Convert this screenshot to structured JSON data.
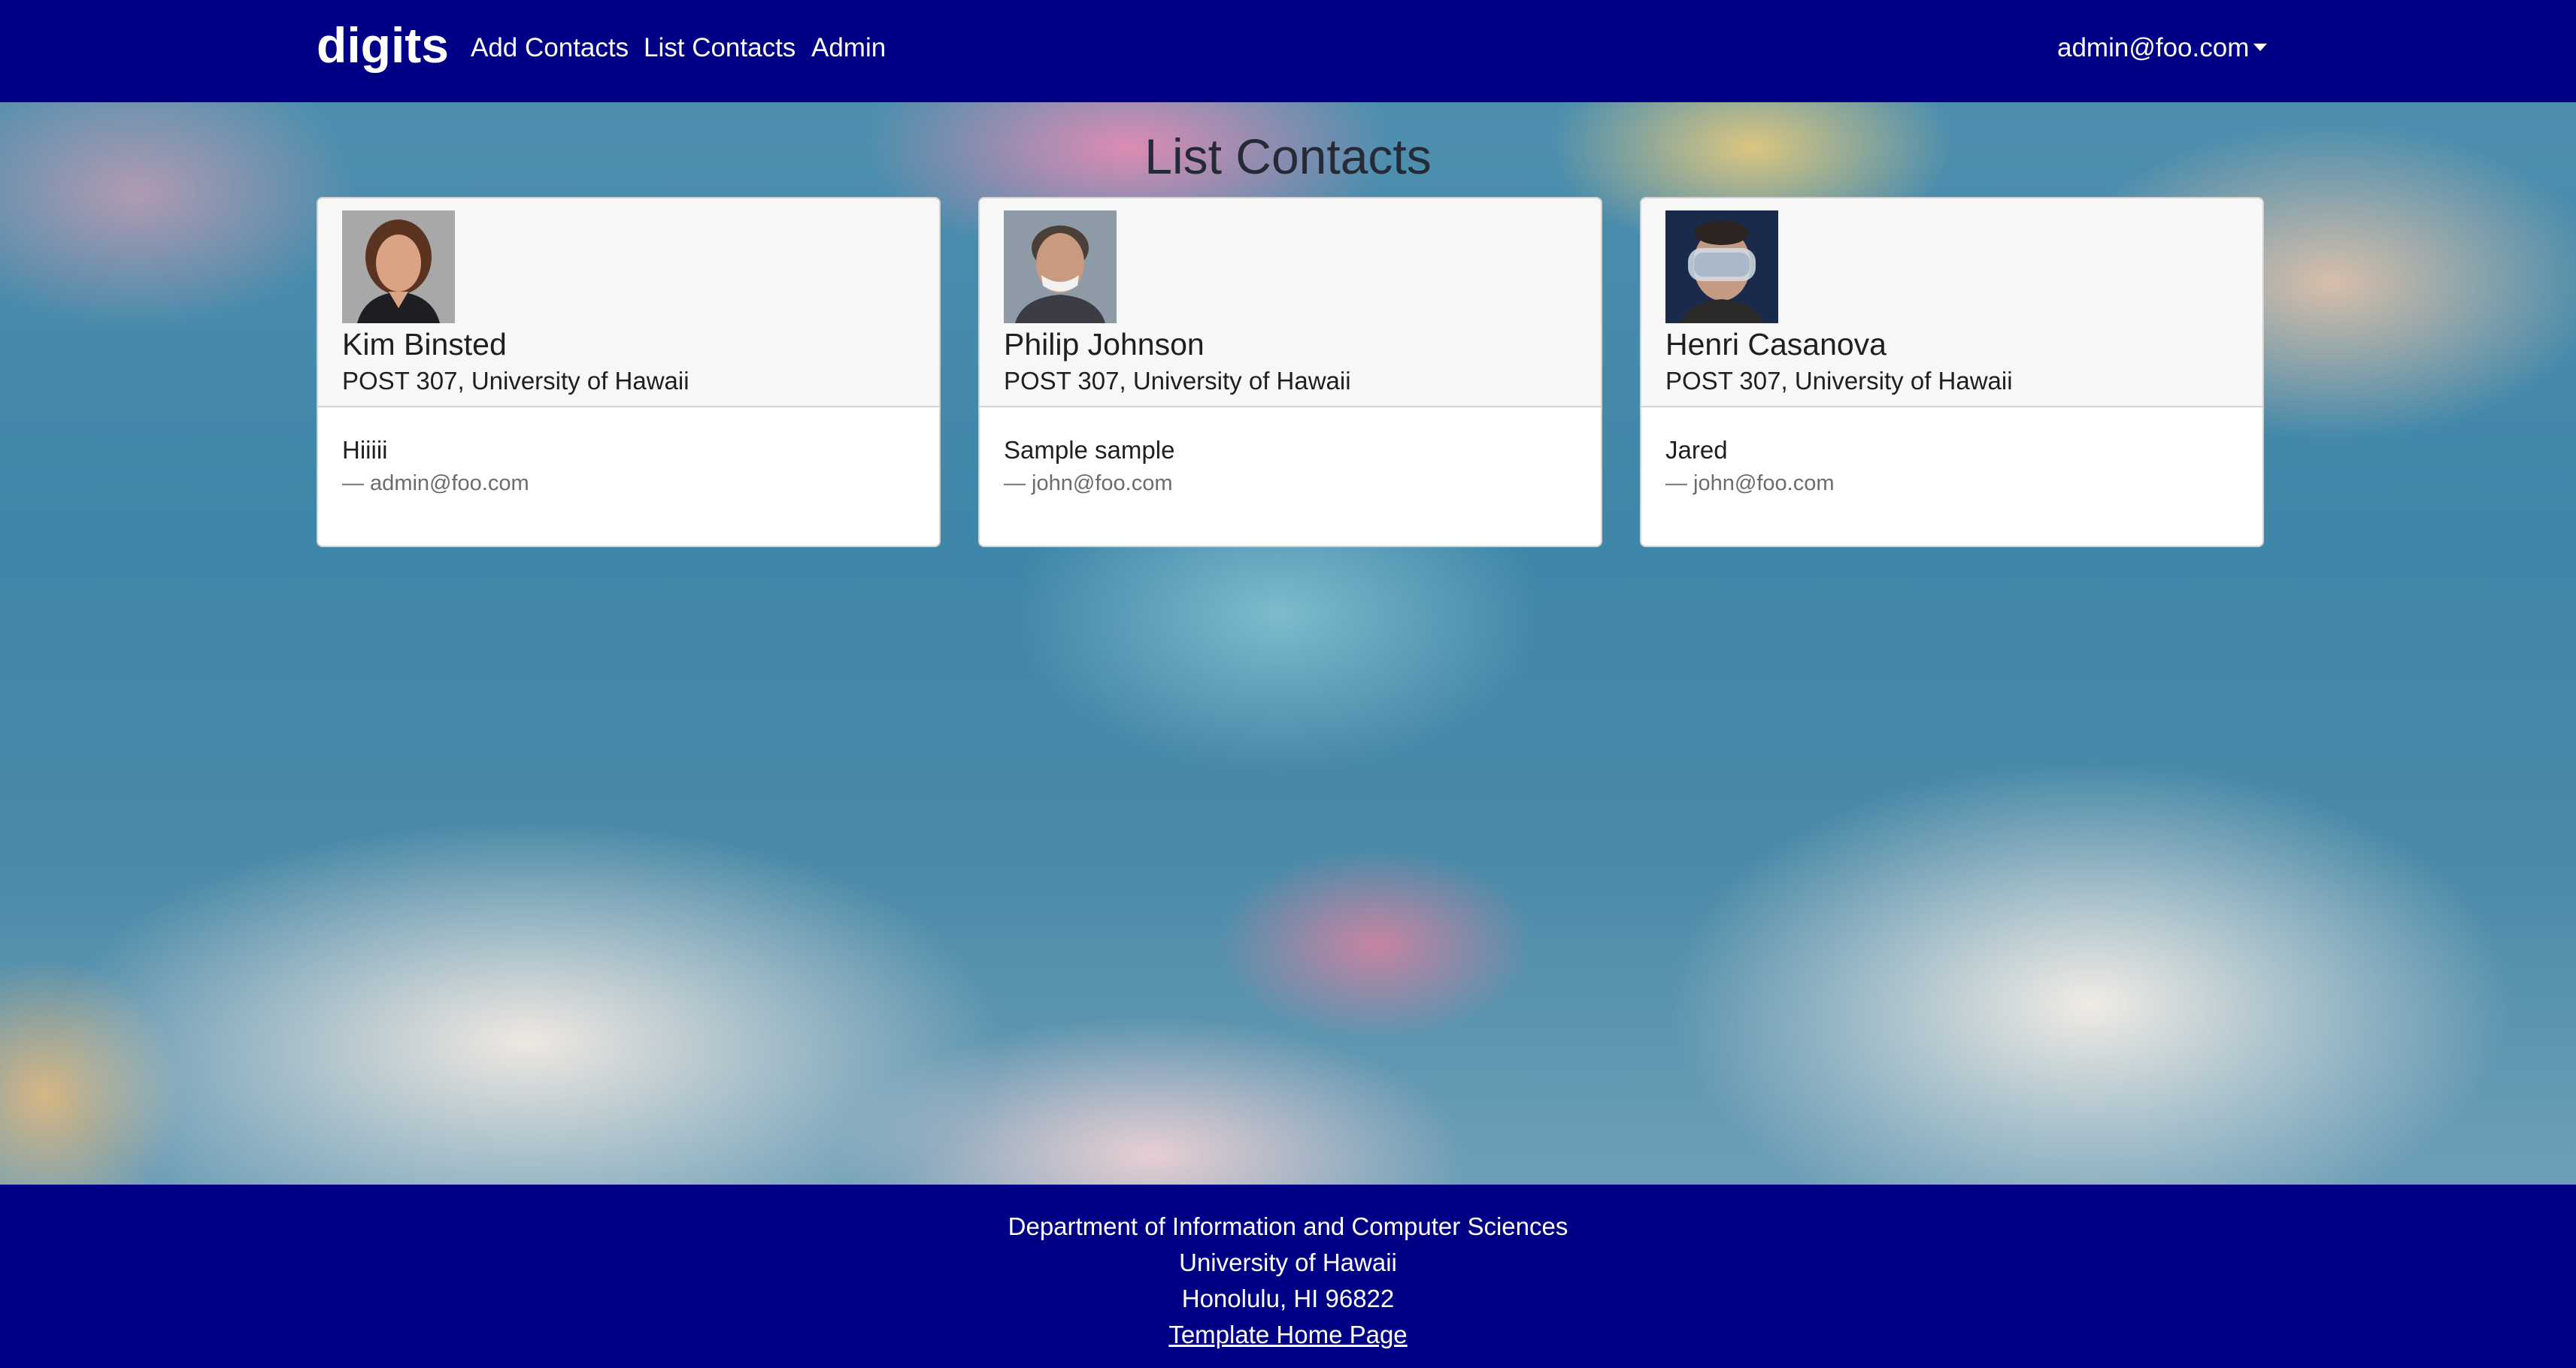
{
  "navbar": {
    "brand": "digits",
    "links": [
      {
        "label": "Add Contacts"
      },
      {
        "label": "List Contacts"
      },
      {
        "label": "Admin"
      }
    ],
    "user_menu": "admin@foo.com"
  },
  "page": {
    "title": "List Contacts"
  },
  "contacts": [
    {
      "name": "Kim Binsted",
      "address": "POST 307, University of Hawaii",
      "note": "Hiiiii",
      "note_owner": "— admin@foo.com"
    },
    {
      "name": "Philip Johnson",
      "address": "POST 307, University of Hawaii",
      "note": "Sample sample",
      "note_owner": "— john@foo.com"
    },
    {
      "name": "Henri Casanova",
      "address": "POST 307, University of Hawaii",
      "note": "Jared",
      "note_owner": "— john@foo.com"
    }
  ],
  "footer": {
    "line1": "Department of Information and Computer Sciences",
    "line2": "University of Hawaii",
    "line3": "Honolulu, HI 96822",
    "link": "Template Home Page"
  },
  "colors": {
    "navbar_bg": "#000087",
    "footer_bg": "#000087",
    "card_header_bg": "#f7f7f7"
  },
  "icons": {
    "user_menu_caret": "caret-down-icon"
  }
}
